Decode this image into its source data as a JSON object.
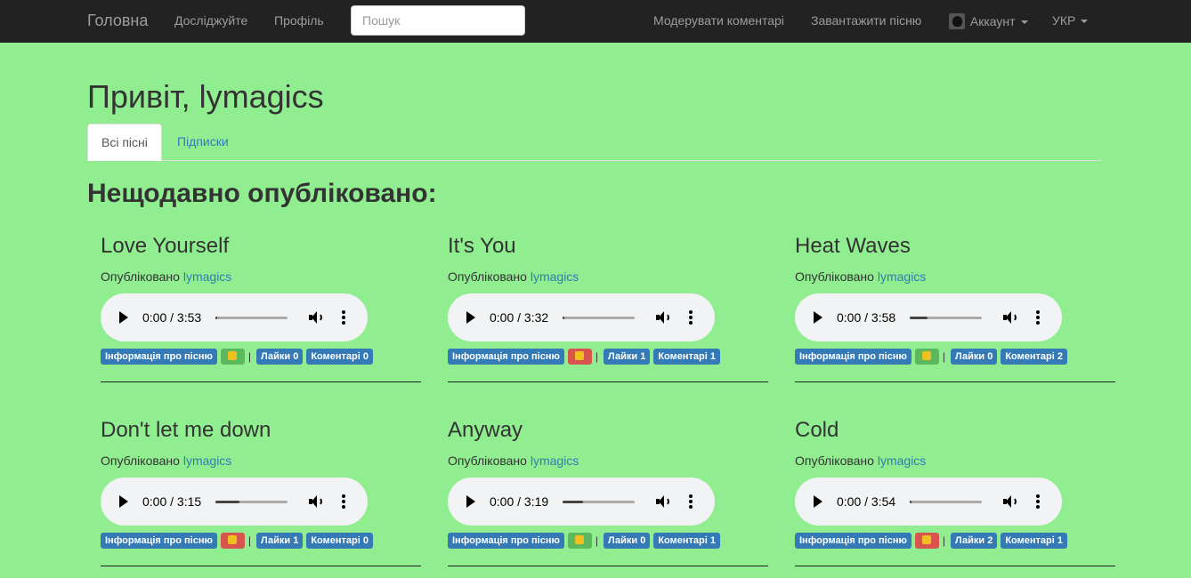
{
  "navbar": {
    "brand": "Головна",
    "explore": "Досліджуйте",
    "profile": "Профіль",
    "search_placeholder": "Пошук",
    "moderate": "Модерувати коментарі",
    "upload": "Завантажити пісню",
    "account": "Аккаунт",
    "language": "УКР"
  },
  "greeting": "Привіт, lymagics",
  "tabs": {
    "all_songs": "Всі пісні",
    "subscriptions": "Підписки"
  },
  "section_title": "Нещодавно опубліковано:",
  "published_prefix": "Опубліковано",
  "info_label": "Інформація про пісню",
  "colors": {
    "background": "#90ee90",
    "navbar": "#222222",
    "link": "#337ab7",
    "info_badge": "#337ab7",
    "like_badge": "#5cb85c",
    "dislike_badge": "#d9534f"
  },
  "songs": [
    {
      "title": "Love Yourself",
      "author": "lymagics",
      "time": "0:00 / 3:53",
      "progress": 0.0,
      "reaction": "like",
      "likes": "Лайки 0",
      "comments": "Коментарі 0"
    },
    {
      "title": "It's You",
      "author": "lymagics",
      "time": "0:00 / 3:32",
      "progress": 0.0,
      "reaction": "dislike",
      "likes": "Лайки 1",
      "comments": "Коментарі 1"
    },
    {
      "title": "Heat Waves",
      "author": "lymagics",
      "time": "0:00 / 3:58",
      "progress": 0.25,
      "reaction": "like",
      "likes": "Лайки 0",
      "comments": "Коментарі 2"
    },
    {
      "title": "Don't let me down",
      "author": "lymagics",
      "time": "0:00 / 3:15",
      "progress": 0.33,
      "reaction": "dislike",
      "likes": "Лайки 1",
      "comments": "Коментарі 0"
    },
    {
      "title": "Anyway",
      "author": "lymagics",
      "time": "0:00 / 3:19",
      "progress": 0.28,
      "reaction": "like",
      "likes": "Лайки 0",
      "comments": "Коментарі 1"
    },
    {
      "title": "Cold",
      "author": "lymagics",
      "time": "0:00 / 3:54",
      "progress": 0.03,
      "reaction": "dislike",
      "likes": "Лайки 2",
      "comments": "Коментарі 1"
    }
  ]
}
